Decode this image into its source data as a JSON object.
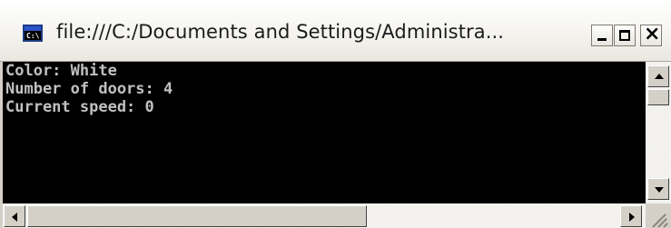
{
  "window": {
    "title": "file:///C:/Documents and Settings/Administra...",
    "icon": "console-window-icon",
    "buttons": {
      "minimize": "minimize-icon",
      "maximize": "maximize-icon",
      "close": "close-icon",
      "close_glyph": "×"
    }
  },
  "console": {
    "lines": [
      "Color: White",
      "Number of doors: 4",
      "Current speed: 0"
    ],
    "background": "#000000",
    "foreground": "#c0c0c0"
  },
  "scrollbars": {
    "vertical": {
      "up_icon": "arrow-up-icon",
      "down_icon": "arrow-down-icon"
    },
    "horizontal": {
      "left_icon": "arrow-left-icon",
      "right_icon": "arrow-right-icon"
    }
  }
}
